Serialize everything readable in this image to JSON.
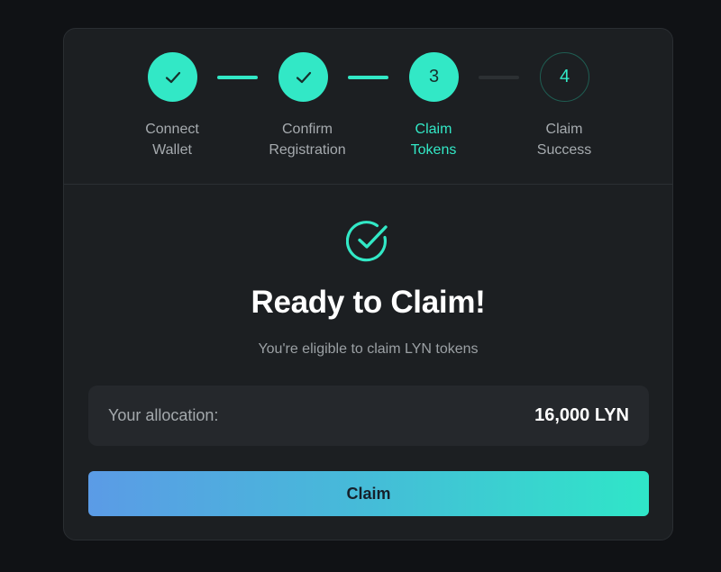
{
  "steps": [
    {
      "label_line1": "Connect",
      "label_line2": "Wallet",
      "state": "done",
      "indicator": "check-icon"
    },
    {
      "label_line1": "Confirm",
      "label_line2": "Registration",
      "state": "done",
      "indicator": "check-icon"
    },
    {
      "label_line1": "Claim",
      "label_line2": "Tokens",
      "state": "active",
      "number": "3"
    },
    {
      "label_line1": "Claim",
      "label_line2": "Success",
      "state": "pending",
      "number": "4"
    }
  ],
  "main": {
    "icon": "check-circle-icon",
    "title": "Ready to Claim!",
    "subtitle": "You're eligible to claim LYN tokens"
  },
  "allocation": {
    "label": "Your allocation:",
    "value": "16,000 LYN"
  },
  "claim_button": {
    "label": "Claim"
  },
  "colors": {
    "accent": "#32e8c6",
    "card_bg": "#1c1f22",
    "page_bg": "#101215",
    "button_gradient_start": "#5b9be6",
    "button_gradient_end": "#2fe6c8"
  }
}
